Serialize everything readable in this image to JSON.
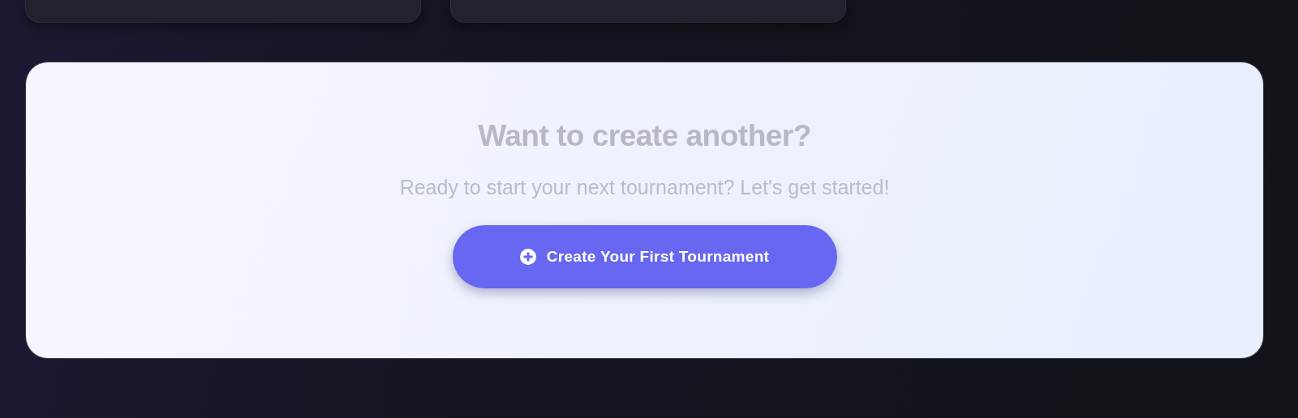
{
  "top_cards": [
    {
      "kind": "card"
    },
    {
      "kind": "card"
    }
  ],
  "cta": {
    "title": "Want to create another?",
    "subtitle": "Ready to start your next tournament? Let's get started!",
    "button": "Create Your First Tournament"
  }
}
